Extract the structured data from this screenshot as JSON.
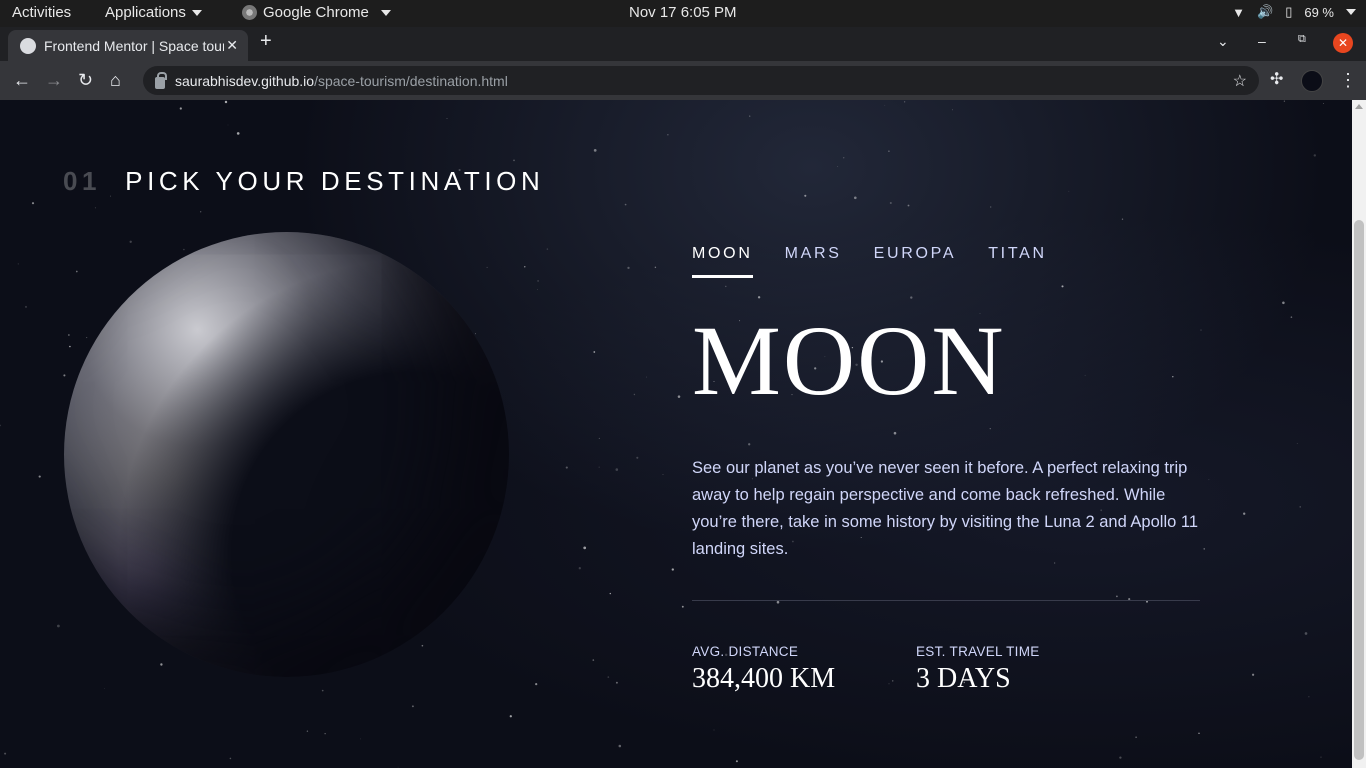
{
  "system_bar": {
    "activities": "Activities",
    "applications": "Applications",
    "app_name": "Google Chrome",
    "clock": "Nov 17   6:05 PM",
    "battery": "69 %"
  },
  "browser": {
    "tab_title": "Frontend Mentor | Space tourism website",
    "url_host": "saurabhisdev.github.io",
    "url_path": "/space-tourism/destination.html"
  },
  "page": {
    "heading_number": "01",
    "heading_text": "PICK YOUR DESTINATION",
    "tabs": [
      {
        "label": "MOON",
        "active": true
      },
      {
        "label": "MARS",
        "active": false
      },
      {
        "label": "EUROPA",
        "active": false
      },
      {
        "label": "TITAN",
        "active": false
      }
    ],
    "destination_name": "MOON",
    "description": "See our planet as you’ve never seen it before. A perfect relaxing trip away to help regain perspective and come back refreshed. While you’re there, take in some history by visiting the Luna 2 and Apollo 11 landing sites.",
    "stats": {
      "distance_label": "AVG. DISTANCE",
      "distance_value": "384,400 KM",
      "travel_label": "EST. TRAVEL TIME",
      "travel_value": "3 DAYS"
    }
  },
  "colors": {
    "background": "#0b0d17",
    "accent_text": "#d0d6f9",
    "white": "#ffffff"
  }
}
